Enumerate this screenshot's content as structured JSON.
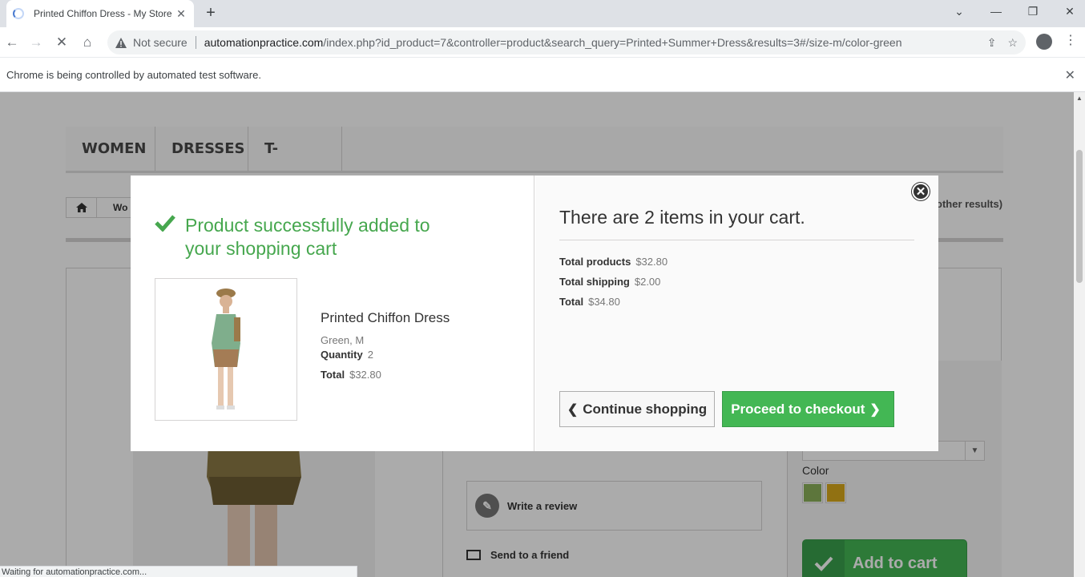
{
  "browser": {
    "tab_title": "Printed Chiffon Dress - My Store",
    "not_secure": "Not secure",
    "url_host": "automationpractice.com",
    "url_rest": "/index.php?id_product=7&controller=product&search_query=Printed+Summer+Dress&results=3#/size-m/color-green",
    "infobar_text": "Chrome is being controlled by automated test software.",
    "status_text": "Waiting for automationpractice.com..."
  },
  "menu": {
    "items": [
      "WOMEN",
      "DRESSES",
      "T-SHIRTS"
    ]
  },
  "breadcrumb": {
    "partial": "Wo"
  },
  "search": {
    "other_results": "other results)"
  },
  "product_page": {
    "write_review": "Write a review",
    "send_friend": "Send to a friend",
    "color_label": "Color",
    "add_to_cart": "Add to cart",
    "swatch_colors": [
      "#8bb05a",
      "#d8a91c"
    ]
  },
  "modal": {
    "success_title": "Product successfully added to your shopping cart",
    "product_name": "Printed Chiffon Dress",
    "attributes": "Green, M",
    "quantity_label": "Quantity",
    "quantity": "2",
    "total_label": "Total",
    "total": "$32.80",
    "cart_count": "There are 2 items in your cart.",
    "total_products_label": "Total products",
    "total_products": "$32.80",
    "total_shipping_label": "Total shipping",
    "total_shipping": "$2.00",
    "grand_total_label": "Total",
    "grand_total": "$34.80",
    "continue_label": "Continue shopping",
    "checkout_label": "Proceed to checkout"
  },
  "colors": {
    "success_green": "#46a74e",
    "button_green": "#43b754"
  }
}
